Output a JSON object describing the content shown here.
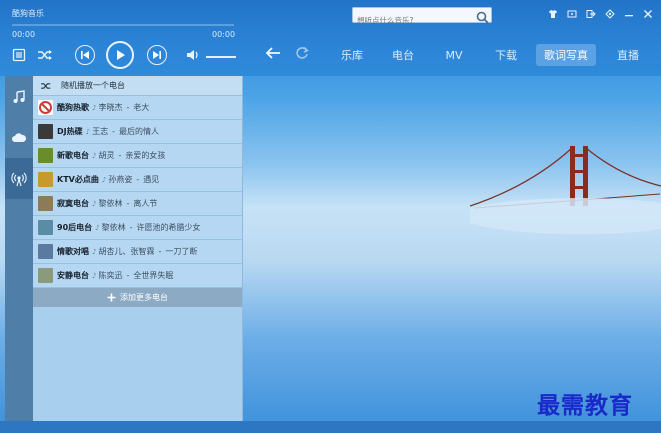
{
  "app": {
    "brand": "酷狗音乐"
  },
  "player": {
    "time_current": "00:00",
    "time_total": "00:00"
  },
  "search": {
    "placeholder": "想听点什么音乐?"
  },
  "nav": {
    "tabs": [
      {
        "label": "乐库"
      },
      {
        "label": "电台"
      },
      {
        "label": "MV"
      },
      {
        "label": "下载"
      },
      {
        "label": "歌词写真"
      },
      {
        "label": "直播"
      }
    ],
    "active_index": 4
  },
  "radio": {
    "header": "随机播放一个电台",
    "stations": [
      {
        "name": "酷狗热歌",
        "artist": "李晓杰",
        "song": "老大",
        "icon": "no-entry-icon",
        "color": "#d23a3a"
      },
      {
        "name": "DJ热碟",
        "artist": "王志",
        "song": "最后的情人",
        "icon": "dj-thumb-icon",
        "color": "#3a3a3a"
      },
      {
        "name": "新歌电台",
        "artist": "胡灵",
        "song": "亲爱的女孩",
        "icon": "new-song-thumb-icon",
        "color": "#6a8c2c"
      },
      {
        "name": "KTV必点曲",
        "artist": "孙燕姿",
        "song": "遇见",
        "icon": "ktv-thumb-icon",
        "color": "#c79a2e"
      },
      {
        "name": "寂寞电台",
        "artist": "黎依林",
        "song": "离人节",
        "icon": "lonely-thumb-icon",
        "color": "#8c7a5a"
      },
      {
        "name": "90后电台",
        "artist": "黎依林",
        "song": "许愿池的希腊少女",
        "icon": "nineties-thumb-icon",
        "color": "#5a8ca6"
      },
      {
        "name": "情歌对唱",
        "artist": "胡杏儿、张智霖",
        "song": "一刀了断",
        "icon": "duet-thumb-icon",
        "color": "#5a7aa0"
      },
      {
        "name": "安静电台",
        "artist": "陈奕迅",
        "song": "全世界失眠",
        "icon": "quiet-thumb-icon",
        "color": "#8a9a7a"
      }
    ],
    "add_more": "添加更多电台"
  },
  "watermark": "最需教育"
}
